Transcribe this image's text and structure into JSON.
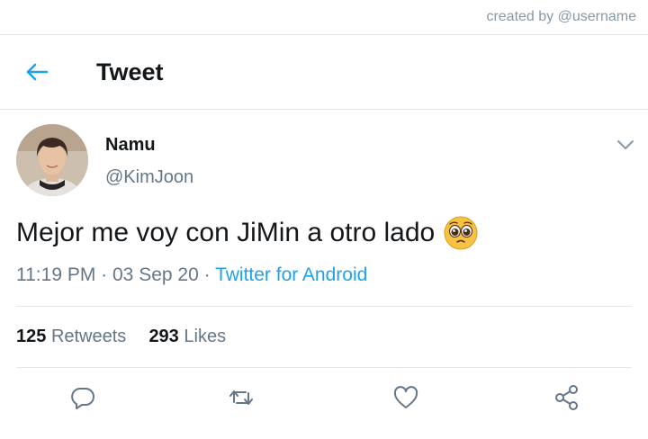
{
  "credit": "created by @username",
  "header": {
    "title": "Tweet"
  },
  "tweet": {
    "author_name": "Namu",
    "author_handle": "@KimJoon",
    "text": "Mejor me voy con JiMin a otro lado",
    "emoji": "pleading-face",
    "time": "11:19 PM",
    "date": "03 Sep 20",
    "source": "Twitter for Android",
    "retweets_count": "125",
    "retweets_label": "Retweets",
    "likes_count": "293",
    "likes_label": "Likes"
  },
  "colors": {
    "accent": "#1da1f2",
    "text_primary": "#14171a",
    "text_secondary": "#657786",
    "divider": "#e1e8ed"
  },
  "icons": [
    "back-arrow-icon",
    "chevron-down-icon",
    "reply-icon",
    "retweet-icon",
    "like-icon",
    "share-icon"
  ]
}
